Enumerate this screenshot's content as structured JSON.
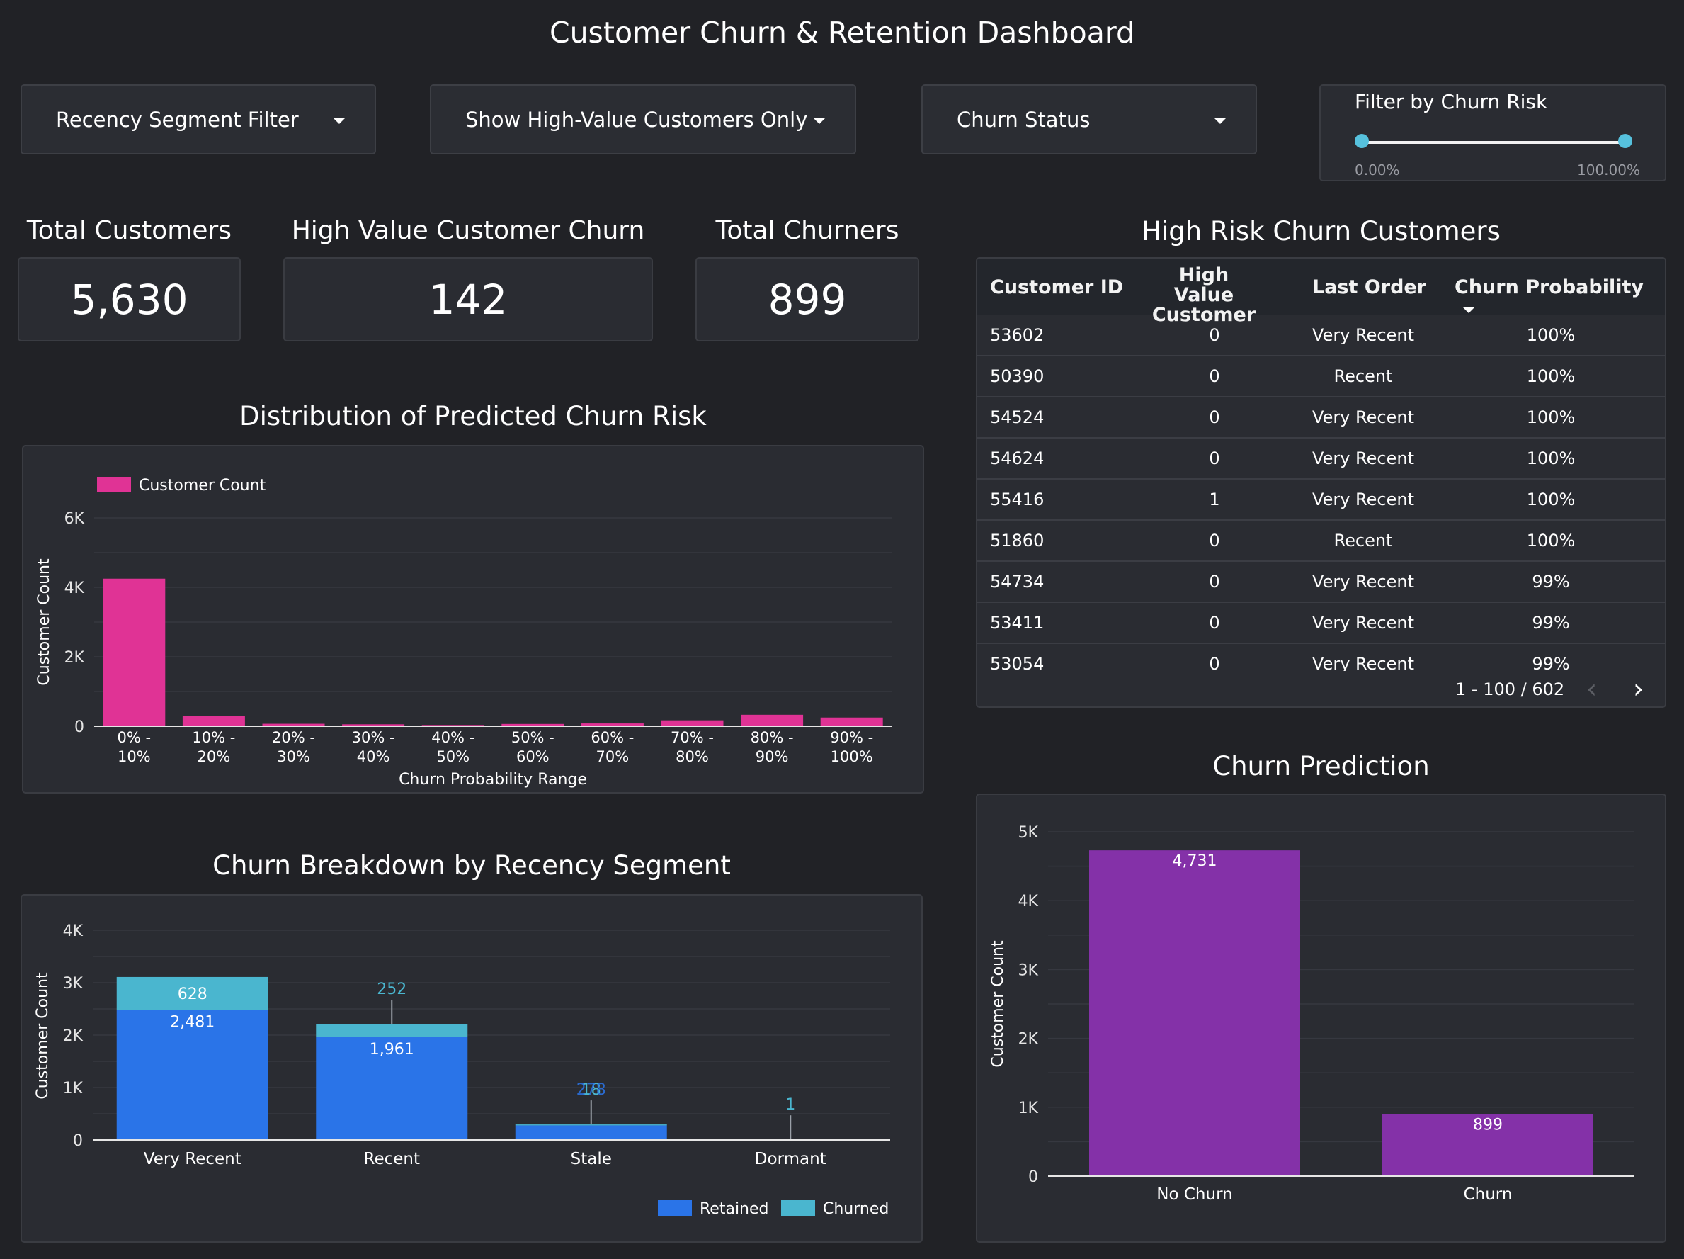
{
  "title": "Customer Churn & Retention Dashboard",
  "filters": {
    "recency": "Recency Segment Filter",
    "high_value": "Show High-Value Customers Only",
    "churn_status": "Churn Status",
    "risk_slider": {
      "label": "Filter by Churn Risk",
      "min_label": "0.00%",
      "max_label": "100.00%",
      "min_value": 0,
      "max_value": 100
    }
  },
  "kpis": {
    "total_customers": {
      "label": "Total Customers",
      "value": "5,630"
    },
    "high_value_churn": {
      "label": "High Value Customer Churn",
      "value": "142"
    },
    "total_churners": {
      "label": "Total Churners",
      "value": "899"
    }
  },
  "table": {
    "title": "High Risk Churn Customers",
    "columns": [
      "Customer ID",
      "High Value",
      "Customer",
      "Last Order",
      "Churn Probability"
    ],
    "rows": [
      [
        "53602",
        "0",
        "Very Recent",
        "100%"
      ],
      [
        "50390",
        "0",
        "Recent",
        "100%"
      ],
      [
        "54524",
        "0",
        "Very Recent",
        "100%"
      ],
      [
        "54624",
        "0",
        "Very Recent",
        "100%"
      ],
      [
        "55416",
        "1",
        "Very Recent",
        "100%"
      ],
      [
        "51860",
        "0",
        "Recent",
        "100%"
      ],
      [
        "54734",
        "0",
        "Very Recent",
        "99%"
      ],
      [
        "53411",
        "0",
        "Very Recent",
        "99%"
      ],
      [
        "53054",
        "0",
        "Very Recent",
        "99%"
      ]
    ],
    "pagination": "1 - 100 / 602"
  },
  "chart_data": [
    {
      "type": "bar",
      "title": "Distribution of Predicted Churn Risk",
      "xlabel": "Churn Probability Range",
      "ylabel": "Customer Count",
      "legend": "top-left",
      "color": "#e03395",
      "categories": [
        [
          "0% -",
          "10%"
        ],
        [
          "10% -",
          "20%"
        ],
        [
          "20% -",
          "30%"
        ],
        [
          "30% -",
          "40%"
        ],
        [
          "40% -",
          "50%"
        ],
        [
          "50% -",
          "60%"
        ],
        [
          "60% -",
          "70%"
        ],
        [
          "70% -",
          "80%"
        ],
        [
          "80% -",
          "90%"
        ],
        [
          "90% -",
          "100%"
        ]
      ],
      "series": [
        {
          "name": "Customer Count",
          "values": [
            4250,
            290,
            70,
            55,
            35,
            65,
            80,
            170,
            330,
            250
          ]
        }
      ],
      "yticks": [
        {
          "v": 0,
          "label": "0"
        },
        {
          "v": 2000,
          "label": "2K"
        },
        {
          "v": 4000,
          "label": "4K"
        },
        {
          "v": 6000,
          "label": "6K"
        }
      ],
      "ylim": [
        0,
        6000
      ]
    },
    {
      "type": "bar",
      "stacked": true,
      "title": "Churn Breakdown by Recency Segment",
      "ylabel": "Customer Count",
      "legend": "bottom-right",
      "categories": [
        "Very Recent",
        "Recent",
        "Stale",
        "Dormant"
      ],
      "series": [
        {
          "name": "Retained",
          "color": "#2a74e8",
          "values": [
            2481,
            1961,
            278,
            10
          ],
          "labels": [
            "2,481",
            "1,961",
            "278",
            ""
          ]
        },
        {
          "name": "Churned",
          "color": "#4ab6cf",
          "values": [
            628,
            252,
            18,
            1
          ],
          "labels": [
            "628",
            "252",
            "18",
            "1"
          ]
        }
      ],
      "yticks": [
        {
          "v": 0,
          "label": "0"
        },
        {
          "v": 1000,
          "label": "1K"
        },
        {
          "v": 2000,
          "label": "2K"
        },
        {
          "v": 3000,
          "label": "3K"
        },
        {
          "v": 4000,
          "label": "4K"
        }
      ],
      "ylim": [
        0,
        4000
      ]
    },
    {
      "type": "bar",
      "title": "Churn Prediction",
      "ylabel": "Customer Count",
      "color": "#8431a8",
      "categories": [
        "No Churn",
        "Churn"
      ],
      "values": [
        4731,
        899
      ],
      "labels": [
        "4,731",
        "899"
      ],
      "yticks": [
        {
          "v": 0,
          "label": "0"
        },
        {
          "v": 1000,
          "label": "1K"
        },
        {
          "v": 2000,
          "label": "2K"
        },
        {
          "v": 3000,
          "label": "3K"
        },
        {
          "v": 4000,
          "label": "4K"
        },
        {
          "v": 5000,
          "label": "5K"
        }
      ],
      "ylim": [
        0,
        5000
      ]
    }
  ]
}
